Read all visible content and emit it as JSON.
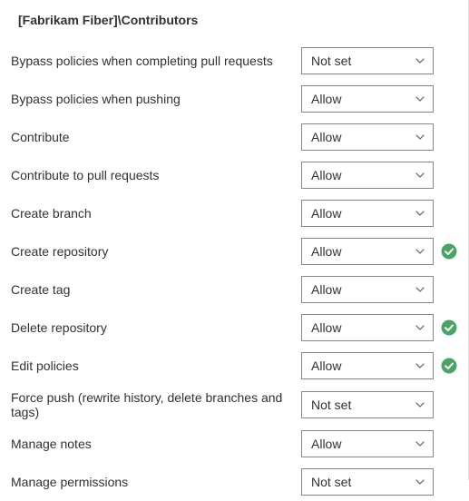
{
  "title": "[Fabrikam Fiber]\\Contributors",
  "permissions": [
    {
      "label": "Bypass policies when completing pull requests",
      "value": "Not set",
      "explicit": false
    },
    {
      "label": "Bypass policies when pushing",
      "value": "Allow",
      "explicit": false
    },
    {
      "label": "Contribute",
      "value": "Allow",
      "explicit": false
    },
    {
      "label": "Contribute to pull requests",
      "value": "Allow",
      "explicit": false
    },
    {
      "label": "Create branch",
      "value": "Allow",
      "explicit": false
    },
    {
      "label": "Create repository",
      "value": "Allow",
      "explicit": true
    },
    {
      "label": "Create tag",
      "value": "Allow",
      "explicit": false
    },
    {
      "label": "Delete repository",
      "value": "Allow",
      "explicit": true
    },
    {
      "label": "Edit policies",
      "value": "Allow",
      "explicit": true
    },
    {
      "label": "Force push (rewrite history, delete branches and tags)",
      "value": "Not set",
      "explicit": false
    },
    {
      "label": "Manage notes",
      "value": "Allow",
      "explicit": false
    },
    {
      "label": "Manage permissions",
      "value": "Not set",
      "explicit": false
    }
  ],
  "colors": {
    "success": "#4aa564",
    "border": "#8a8886"
  }
}
